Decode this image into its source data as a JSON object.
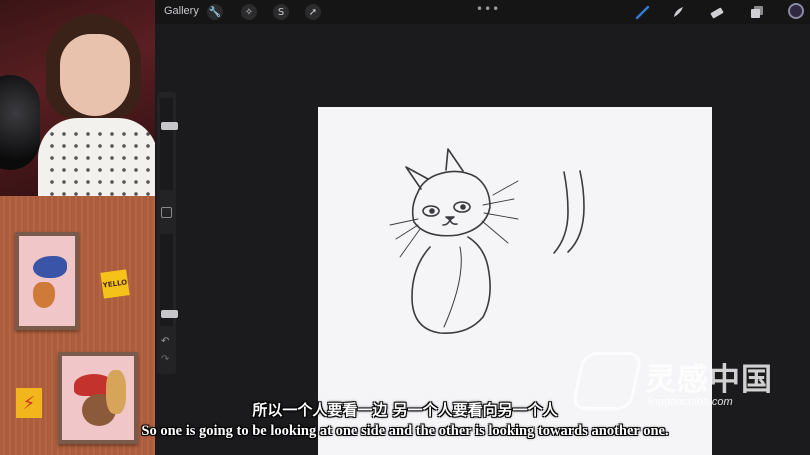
{
  "toolbar": {
    "gallery_label": "Gallery",
    "left_tools": [
      "wrench-icon",
      "magic-wand-icon",
      "selection-icon",
      "arrow-icon"
    ],
    "more_label": "•••",
    "right_tools": [
      "brush-icon",
      "smudge-icon",
      "eraser-icon",
      "layers-icon"
    ],
    "accent_color": "#2f7bd6",
    "current_color": "#2e2840"
  },
  "sidebar": {
    "size_slider_value": 0.72,
    "opacity_slider_value": 0.1
  },
  "decor": {
    "sticky_note_text": "YELLO"
  },
  "watermark": {
    "brand_cn": "灵感中国",
    "url": "lingganchina.com"
  },
  "subtitles": {
    "chinese": "所以一个人要看一边 另一个人要看向另一个人",
    "english": "So one is going to be looking at one side and the other is looking towards another one."
  }
}
